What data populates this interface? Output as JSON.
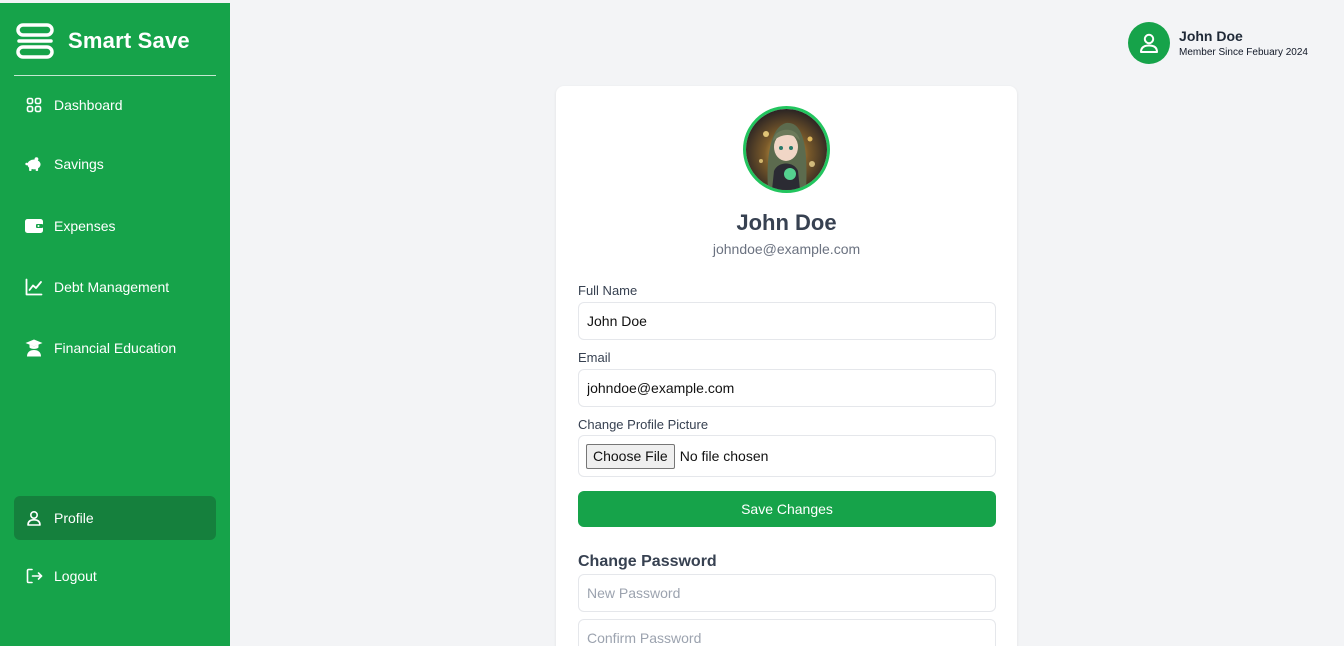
{
  "app": {
    "title": "Smart Save"
  },
  "sidebar": {
    "items": [
      {
        "label": "Dashboard",
        "icon": "grid-icon"
      },
      {
        "label": "Savings",
        "icon": "piggy-bank-icon"
      },
      {
        "label": "Expenses",
        "icon": "wallet-icon"
      },
      {
        "label": "Debt Management",
        "icon": "chart-line-icon"
      },
      {
        "label": "Financial Education",
        "icon": "graduate-icon"
      }
    ],
    "profile": {
      "label": "Profile",
      "icon": "user-icon",
      "active": true
    },
    "logout": {
      "label": "Logout",
      "icon": "logout-icon"
    }
  },
  "header": {
    "user_name": "John Doe",
    "member_since": "Member Since Febuary 2024"
  },
  "profile": {
    "name": "John Doe",
    "email": "johndoe@example.com",
    "form": {
      "full_name_label": "Full Name",
      "full_name_value": "John Doe",
      "email_label": "Email",
      "email_value": "johndoe@example.com",
      "picture_label": "Change Profile Picture",
      "choose_file": "Choose File",
      "file_status": "No file chosen",
      "save_label": "Save Changes"
    },
    "password": {
      "title": "Change Password",
      "new_placeholder": "New Password",
      "confirm_placeholder": "Confirm Password"
    }
  },
  "colors": {
    "primary": "#16a34a",
    "active": "#15803d",
    "background": "#f3f4f6"
  }
}
